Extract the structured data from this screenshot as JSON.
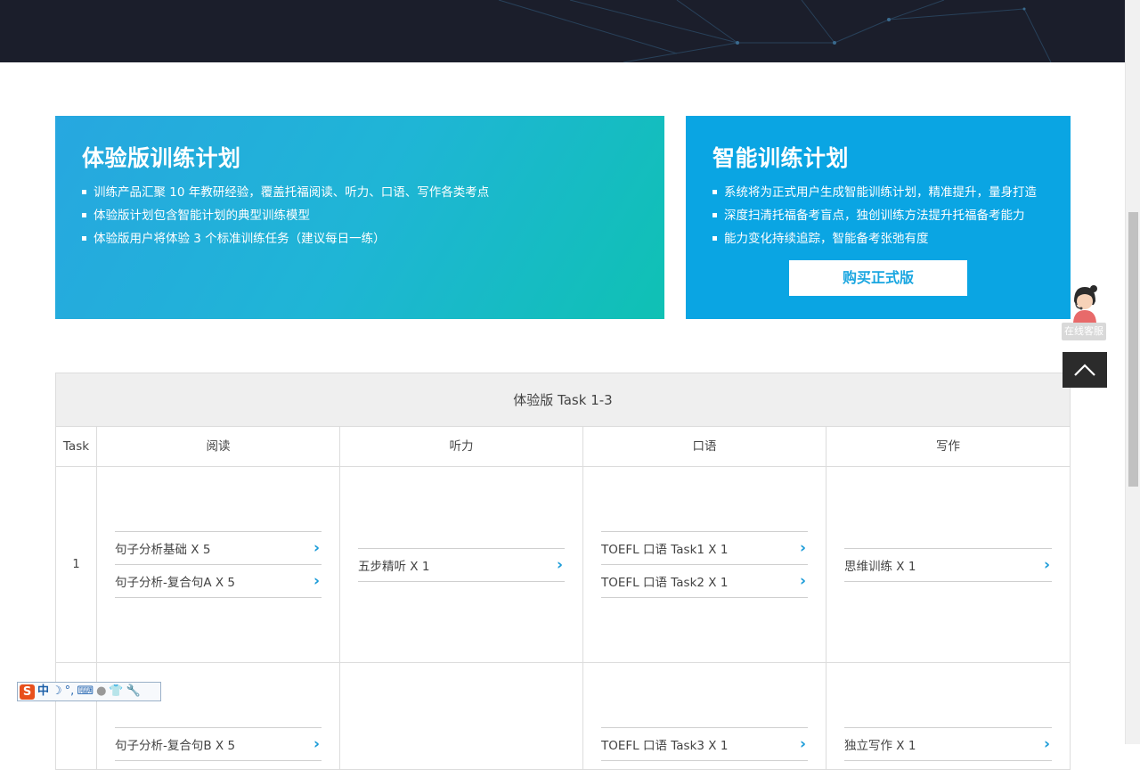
{
  "trial_card": {
    "title": "体验版训练计划",
    "bullets": [
      "训练产品汇聚 10 年教研经验，覆盖托福阅读、听力、口语、写作各类考点",
      "体验版计划包含智能计划的典型训练模型",
      "体验版用户将体验 3 个标准训练任务（建议每日一练）"
    ]
  },
  "smart_card": {
    "title": "智能训练计划",
    "bullets": [
      "系统将为正式用户生成智能训练计划，精准提升，量身打造",
      "深度扫清托福备考盲点，独创训练方法提升托福备考能力",
      "能力变化持续追踪，智能备考张弛有度"
    ],
    "buy_button": "购买正式版"
  },
  "task_table": {
    "title": "体验版 Task 1-3",
    "columns": [
      "Task",
      "阅读",
      "听力",
      "口语",
      "写作"
    ],
    "rows": [
      {
        "task": "1",
        "reading": [
          "句子分析基础 X 5",
          "句子分析-复合句A X 5"
        ],
        "listening": [
          "五步精听 X 1"
        ],
        "speaking": [
          "TOEFL 口语 Task1 X 1",
          "TOEFL 口语 Task2 X 1"
        ],
        "writing": [
          "思维训练 X 1"
        ]
      },
      {
        "task": "",
        "reading": [
          "句子分析-复合句B X 5"
        ],
        "listening": [],
        "speaking": [
          "TOEFL 口语 Task3 X 1"
        ],
        "writing": [
          "独立写作 X 1"
        ]
      }
    ]
  },
  "customer_service": {
    "label": "在线客服"
  },
  "ime_toolbar": {
    "logo": "S",
    "mode": "中"
  },
  "colors": {
    "trial_start": "#27a7e0",
    "trial_end": "#0fc1b4",
    "smart_bg": "#0aa5e3",
    "accent": "#1a9bd8",
    "hero_bg": "#1b1e2b"
  }
}
